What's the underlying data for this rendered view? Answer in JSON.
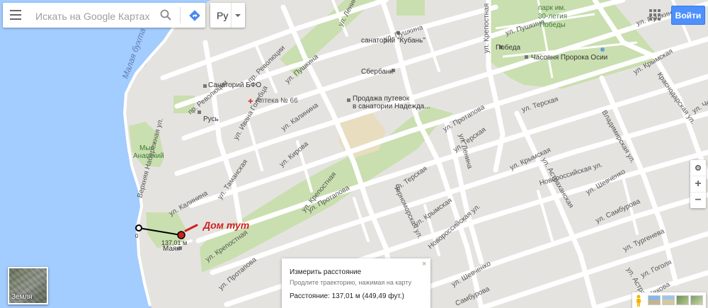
{
  "search": {
    "placeholder": "Искать на Google Картах"
  },
  "language": {
    "value": "Ру"
  },
  "header": {
    "login_label": "Войти"
  },
  "icons": {
    "menu": "menu-icon",
    "search": "search-icon",
    "directions": "directions-icon",
    "apps": "apps-grid-icon",
    "my_location": "my-location-icon",
    "zoom_in": "plus-icon",
    "zoom_out": "minus-icon",
    "pegman": "pegman-icon",
    "close": "close-icon"
  },
  "zoom": {
    "in_label": "+",
    "out_label": "−"
  },
  "earth": {
    "label": "Земля"
  },
  "measure": {
    "title": "Измерить расстояние",
    "hint": "Продлите траекторию, нажимая на карту",
    "distance": "Расстояние: 137,01 м (449,49 фут.)",
    "close_label": "×",
    "segment_label": "137,01 м",
    "start_label": "0"
  },
  "annotation": {
    "text": "Дом тут",
    "color": "#d21f1f"
  },
  "colors": {
    "water": "#a3ccff",
    "park": "#c9dfaf",
    "road": "#ffffff",
    "land": "#e5e3df",
    "button": "#4d90fe",
    "line": "#000000",
    "point": "#d21f1f"
  },
  "map": {
    "water_labels": [
      "Малая бухта"
    ],
    "park_labels": [
      "парк им.",
      "30-летия",
      "Победы",
      "Мыс",
      "Анапский"
    ],
    "streets": [
      "ул. Ленина",
      "ул. Пушкина",
      "ул. Пушкина",
      "ул. Пушкина",
      "ул. Пушкина",
      "пр. Революции",
      "пр. Революции",
      "ул. Ивана Голубца",
      "ул. Калинина",
      "ул. Калинина",
      "ул. Кирова",
      "Верхняя Набережная ул.",
      "ул. Таманская",
      "ул. Крепостная",
      "ул. Крепостная",
      "ул. Крепостная",
      "ул. Протапова",
      "ул. Протапова",
      "ул. Протапова",
      "ул. Терская",
      "ул. Терская",
      "ул. Терская",
      "ул. Крымская",
      "ул. Крымская",
      "ул. Крымская",
      "Черноморская ул.",
      "Новороссийская ул.",
      "Новороссийская ул.",
      "ул. Шевченко",
      "ул. Шевченко",
      "ул. Астраханская",
      "ул. Астраханская",
      "ул. Самбурова",
      "Самбурова",
      "ул. Тургенева",
      "ул. Гоголя",
      "Краснодарская ул.",
      "Владимирская ул.",
      "ул. Ленина",
      "ул. Чехова",
      "ул. Чехова"
    ],
    "pois": [
      "санаторий \"Кубань\"",
      "Сбербанк",
      "Санаторий БФО",
      "Аптека № 66",
      "Продажа путевок",
      "в санатории Надежда...",
      "Русь",
      "Победа",
      "Часовня Пророка Осии",
      "Маяк"
    ]
  }
}
